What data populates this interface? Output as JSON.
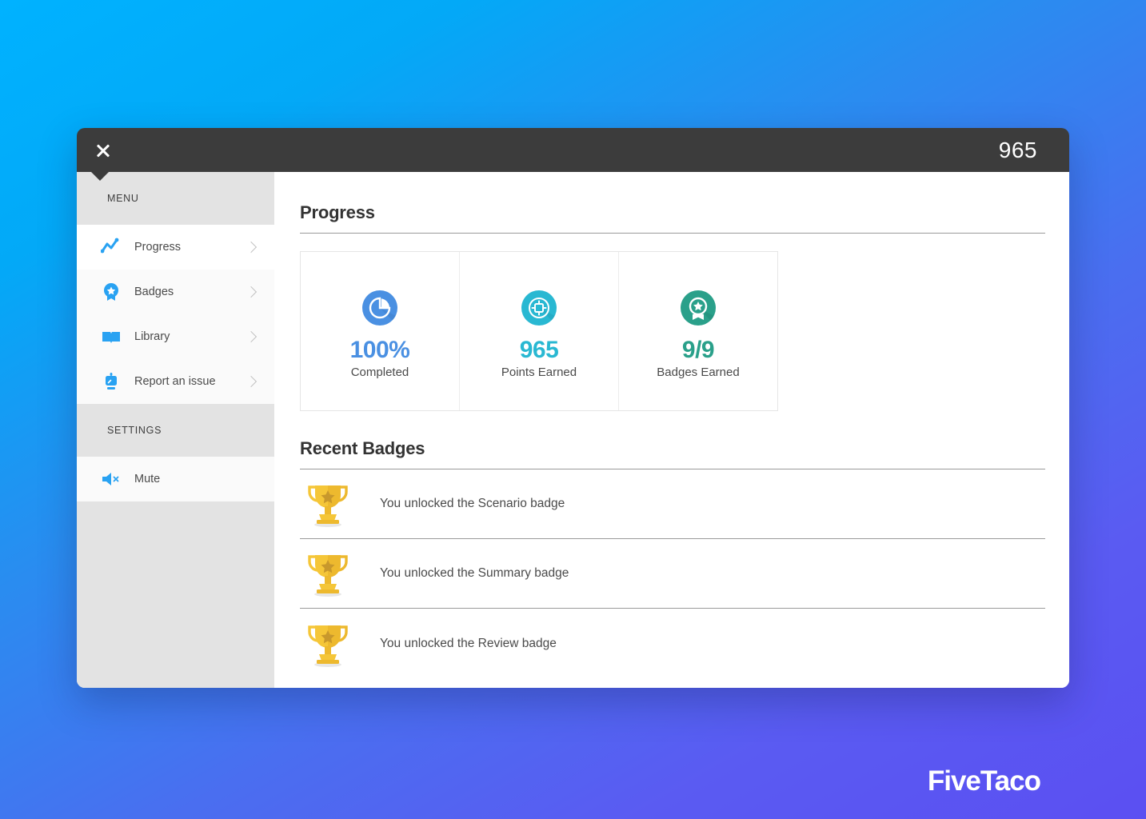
{
  "titlebar": {
    "close_icon": "close-icon",
    "score": "965"
  },
  "sidebar": {
    "sections": [
      {
        "header": "MENU",
        "items": [
          {
            "label": "Progress",
            "icon": "line-chart-icon"
          },
          {
            "label": "Badges",
            "icon": "award-ribbon-icon"
          },
          {
            "label": "Library",
            "icon": "open-book-icon"
          },
          {
            "label": "Report an issue",
            "icon": "report-issue-icon"
          }
        ]
      },
      {
        "header": "SETTINGS",
        "items": [
          {
            "label": "Mute",
            "icon": "speaker-mute-icon"
          }
        ]
      }
    ]
  },
  "main": {
    "progress": {
      "title": "Progress",
      "stats": [
        {
          "value": "100%",
          "label": "Completed",
          "icon": "pie-chart-icon",
          "color": "#4a90e2"
        },
        {
          "value": "965",
          "label": "Points Earned",
          "icon": "target-coin-icon",
          "color": "#29b8d2"
        },
        {
          "value": "9/9",
          "label": "Badges Earned",
          "icon": "award-medal-icon",
          "color": "#2aa08a"
        }
      ]
    },
    "recent_badges": {
      "title": "Recent Badges",
      "items": [
        {
          "text": "You unlocked the Scenario badge",
          "icon": "trophy-icon"
        },
        {
          "text": "You unlocked the Summary badge",
          "icon": "trophy-icon"
        },
        {
          "text": "You unlocked the Review badge",
          "icon": "trophy-icon"
        }
      ]
    }
  },
  "watermark": {
    "text": "FiveTaco"
  },
  "colors": {
    "accent_blue": "#29a2f2",
    "titlebar": "#3c3c3c",
    "sidebar_gray": "#e3e3e3",
    "bg_top": "#00b2ff",
    "bg_bottom": "#5b4ff2"
  }
}
